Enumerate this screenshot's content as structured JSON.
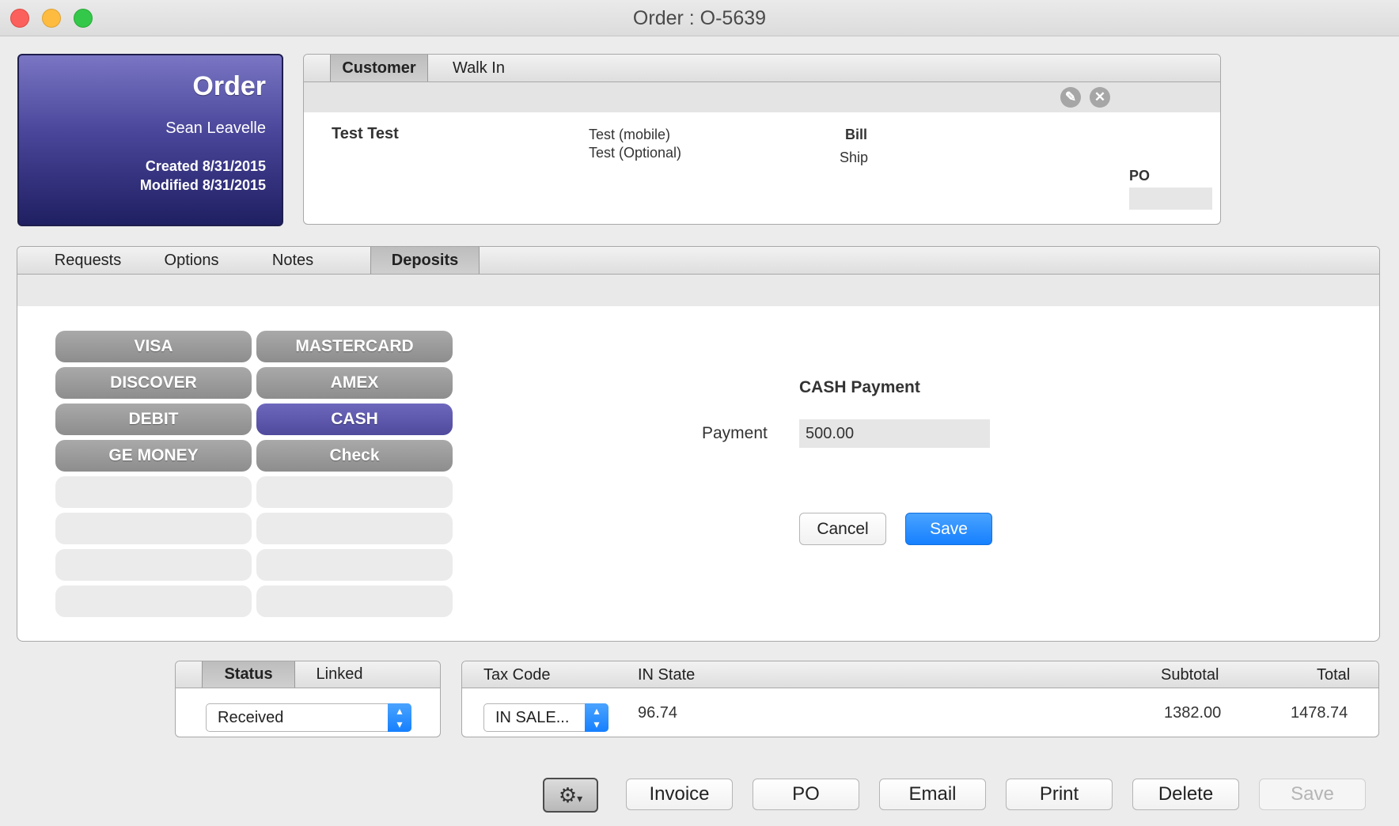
{
  "window": {
    "title": "Order : O-5639"
  },
  "order_card": {
    "title": "Order",
    "name": "Sean Leavelle",
    "created": "Created 8/31/2015",
    "modified": "Modified 8/31/2015"
  },
  "customer": {
    "tabs": [
      "Customer",
      "Walk In"
    ],
    "name": "Test Test",
    "phone_mobile": "Test (mobile)",
    "phone_optional": "Test (Optional)",
    "bill_label": "Bill",
    "ship_label": "Ship",
    "po_label": "PO",
    "po_value": ""
  },
  "main_tabs": [
    "Requests",
    "Options",
    "Notes",
    "Deposits"
  ],
  "payment_methods": [
    "VISA",
    "MASTERCARD",
    "DISCOVER",
    "AMEX",
    "DEBIT",
    "CASH",
    "GE MONEY",
    "Check"
  ],
  "selected_method": "CASH",
  "payment_form": {
    "title": "CASH Payment",
    "payment_label": "Payment",
    "payment_value": "500.00",
    "cancel_label": "Cancel",
    "save_label": "Save"
  },
  "status_panel": {
    "tabs": [
      "Status",
      "Linked"
    ],
    "status_value": "Received"
  },
  "tax_panel": {
    "tax_code_label": "Tax Code",
    "in_state_label": "IN State",
    "subtotal_label": "Subtotal",
    "total_label": "Total",
    "tax_code_value": "IN SALE...",
    "in_state_value": "96.74",
    "subtotal_value": "1382.00",
    "total_value": "1478.74"
  },
  "toolbar": {
    "gear_icon": "gear-icon",
    "invoice": "Invoice",
    "po": "PO",
    "email": "Email",
    "print": "Print",
    "delete": "Delete",
    "save": "Save"
  },
  "colors": {
    "accent_blue": "#1680ff",
    "order_card_top": "#7a76c4",
    "order_card_bottom": "#1f1f62",
    "selected_method": "#5a55a8"
  }
}
